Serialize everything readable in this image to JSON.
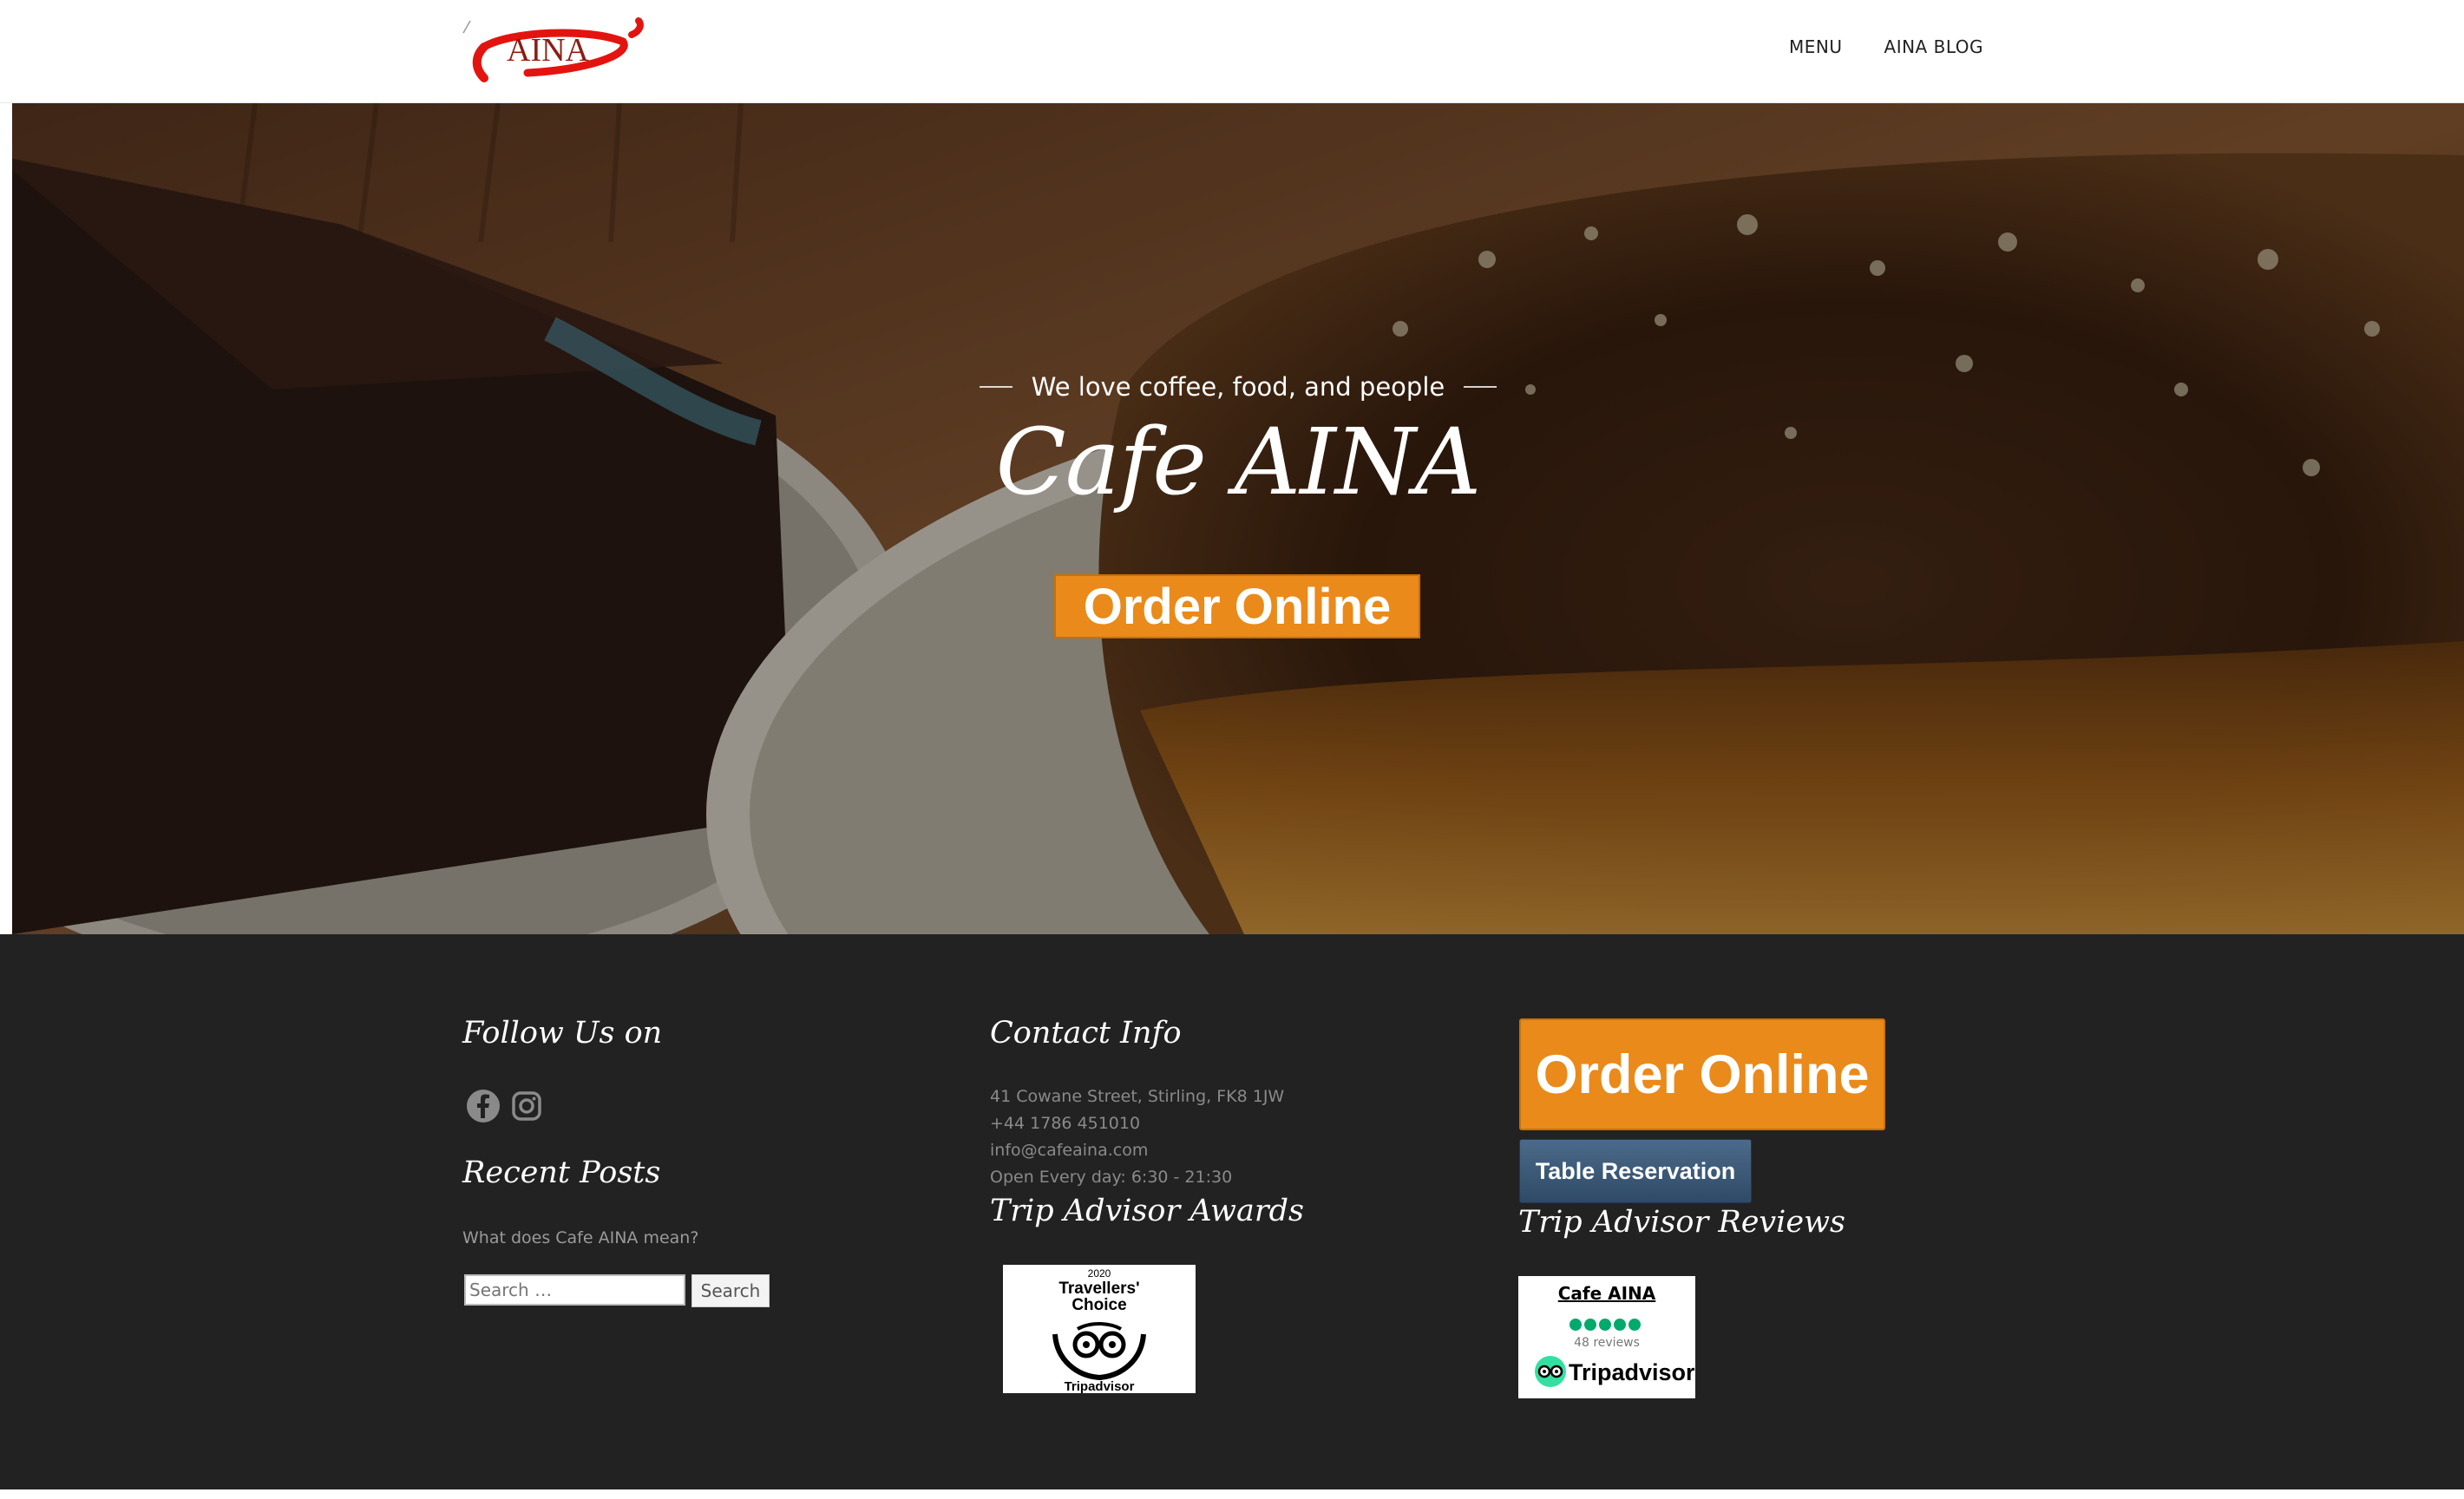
{
  "header": {
    "logo_text": "AINA",
    "nav": [
      "MENU",
      "AINA BLOG"
    ]
  },
  "hero": {
    "tagline": "We love coffee, food, and people",
    "title": "Cafe AINA",
    "order_button": "Order Online"
  },
  "footer": {
    "follow": {
      "heading": "Follow Us on",
      "icons": [
        "facebook-icon",
        "instagram-icon"
      ]
    },
    "recent_posts": {
      "heading": "Recent Posts",
      "items": [
        "What does Cafe AINA mean?"
      ]
    },
    "search": {
      "placeholder": "Search …",
      "button": "Search"
    },
    "contact": {
      "heading": "Contact Info",
      "lines": [
        "41 Cowane Street, Stirling, FK8 1JW",
        "+44 1786 451010",
        "info@cafeaina.com",
        "Open Every day: 6:30 - 21:30"
      ]
    },
    "awards": {
      "heading": "Trip Advisor Awards",
      "badge_year": "2020",
      "badge_line1": "Travellers'",
      "badge_line2": "Choice",
      "badge_brand": "Tripadvisor"
    },
    "actions": {
      "order_button": "Order Online",
      "table_button": "Table Reservation"
    },
    "reviews": {
      "heading": "Trip Advisor Reviews",
      "name": "Cafe AINA",
      "count": "48 reviews",
      "rating": 5,
      "brand": "Tripadvisor"
    }
  },
  "colors": {
    "accent_orange": "#e98a1a",
    "logo_red": "#e3140f",
    "footer_bg": "#222222",
    "tripadvisor_green": "#00aa6c"
  }
}
